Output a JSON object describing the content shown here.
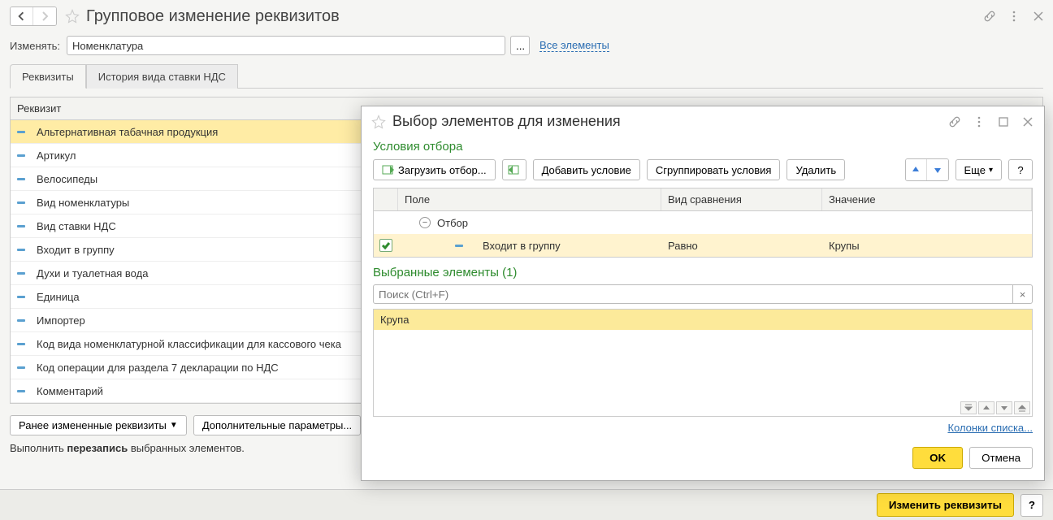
{
  "header": {
    "title": "Групповое изменение реквизитов"
  },
  "filter": {
    "label": "Изменять:",
    "value": "Номенклатура",
    "all_link": "Все элементы"
  },
  "tabs": [
    {
      "label": "Реквизиты",
      "active": true
    },
    {
      "label": "История вида ставки НДС",
      "active": false
    }
  ],
  "attr_table": {
    "header": "Реквизит",
    "rows": [
      "Альтернативная табачная продукция",
      "Артикул",
      "Велосипеды",
      "Вид номенклатуры",
      "Вид ставки НДС",
      "Входит в группу",
      "Духи и туалетная вода",
      "Единица",
      "Импортер",
      "Код вида номенклатурной классификации для кассового чека",
      "Код операции для раздела 7 декларации по НДС",
      "Комментарий"
    ],
    "selected_index": 0
  },
  "bottom": {
    "prev_changed": "Ранее измененные реквизиты",
    "extra_params": "Дополнительные параметры...",
    "note_pre": "Выполнить ",
    "note_bold": "перезапись",
    "note_post": " выбранных элементов."
  },
  "footer": {
    "change": "Изменить реквизиты",
    "help": "?"
  },
  "dialog": {
    "title": "Выбор элементов для изменения",
    "section_filter": "Условия отбора",
    "toolbar": {
      "load": "Загрузить отбор...",
      "add": "Добавить условие",
      "group": "Сгруппировать условия",
      "delete": "Удалить",
      "more": "Еще",
      "help": "?"
    },
    "ft_cols": {
      "field": "Поле",
      "cmp": "Вид сравнения",
      "val": "Значение"
    },
    "ft_group_label": "Отбор",
    "ft_row": {
      "field": "Входит в группу",
      "cmp": "Равно",
      "val": "Крупы"
    },
    "selected_heading": "Выбранные элементы (1)",
    "search_placeholder": "Поиск (Ctrl+F)",
    "selected_item": "Крупа",
    "cols_link": "Колонки списка...",
    "ok": "OK",
    "cancel": "Отмена"
  }
}
